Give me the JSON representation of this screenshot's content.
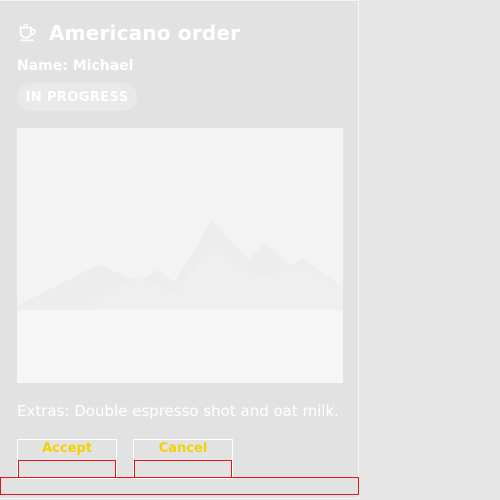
{
  "card": {
    "icon": "coffee-cup-icon",
    "title": "Americano order",
    "name_line": "Name: Michael",
    "status": "IN PROGRESS",
    "extras": "Extras: Double espresso shot and oat milk."
  },
  "actions": {
    "accept_label": "Accept",
    "cancel_label": "Cancel"
  },
  "colors": {
    "background": "#e6e6e6",
    "card": "#e2e2e2",
    "text": "#ffffff",
    "button_label": "#f2d200",
    "outline": "#dd1a1a"
  }
}
